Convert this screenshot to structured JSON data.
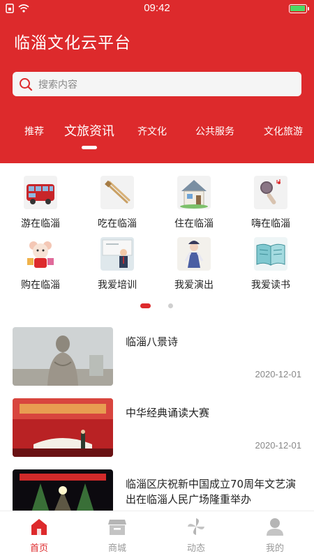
{
  "status_bar": {
    "time": "09:42"
  },
  "app": {
    "title": "临淄文化云平台"
  },
  "search": {
    "placeholder": "搜索内容"
  },
  "tabs": [
    {
      "label": "推荐",
      "active": false
    },
    {
      "label": "文旅资讯",
      "active": true
    },
    {
      "label": "齐文化",
      "active": false
    },
    {
      "label": "公共服务",
      "active": false
    },
    {
      "label": "文化旅游",
      "active": false
    }
  ],
  "grid": [
    {
      "label": "游在临淄",
      "icon": "bus-icon"
    },
    {
      "label": "吃在临淄",
      "icon": "chopsticks-icon"
    },
    {
      "label": "住在临淄",
      "icon": "house-icon"
    },
    {
      "label": "嗨在临淄",
      "icon": "microphone-icon"
    },
    {
      "label": "购在临淄",
      "icon": "shopping-mouse-icon"
    },
    {
      "label": "我爱培训",
      "icon": "teacher-icon"
    },
    {
      "label": "我爱演出",
      "icon": "opera-performer-icon"
    },
    {
      "label": "我爱读书",
      "icon": "open-book-icon"
    }
  ],
  "news": [
    {
      "title": "临淄八景诗",
      "date": "2020-12-01",
      "thumb": "statue-photo"
    },
    {
      "title": "中华经典诵读大赛",
      "date": "2020-12-01",
      "thumb": "stage-photo"
    },
    {
      "title": "临淄区庆祝新中国成立70周年文艺演出在临淄人民广场隆重举办",
      "date": "",
      "thumb": "concert-photo"
    }
  ],
  "tabbar": [
    {
      "label": "首页",
      "icon": "home-icon",
      "active": true
    },
    {
      "label": "商城",
      "icon": "store-icon",
      "active": false
    },
    {
      "label": "动态",
      "icon": "pinwheel-icon",
      "active": false
    },
    {
      "label": "我的",
      "icon": "user-icon",
      "active": false
    }
  ],
  "colors": {
    "brand": "#dd2a2c",
    "muted": "#999999"
  }
}
